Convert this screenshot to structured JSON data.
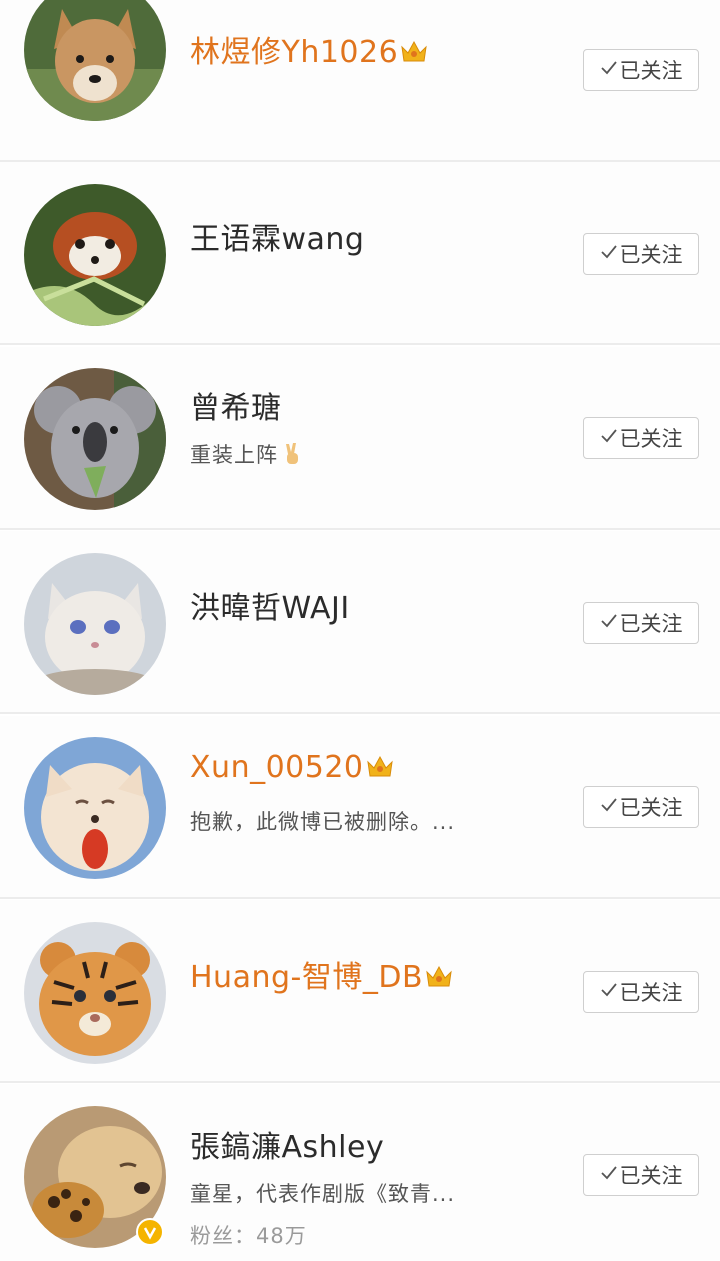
{
  "accent": {
    "vip_name_color": "#e0741d",
    "verified_badge_color": "#f5b400"
  },
  "users": [
    {
      "name": "林煜修Yh1026",
      "vip": true,
      "description": "",
      "follow_label": "已关注",
      "avatar_icon": "fox-cub-avatar"
    },
    {
      "name": "王语霖wang",
      "vip": false,
      "description": "",
      "follow_label": "已关注",
      "avatar_icon": "red-panda-avatar"
    },
    {
      "name": "曾希瑭",
      "vip": false,
      "description": "重装上阵",
      "description_emoji": "victory-hand-icon",
      "follow_label": "已关注",
      "avatar_icon": "koala-avatar"
    },
    {
      "name": "洪暐哲WAJI",
      "vip": false,
      "description": "",
      "follow_label": "已关注",
      "avatar_icon": "white-cat-avatar"
    },
    {
      "name": "Xun_00520",
      "vip": true,
      "description": "抱歉，此微博已被删除。...",
      "follow_label": "已关注",
      "avatar_icon": "arctic-fox-avatar"
    },
    {
      "name": "Huang-智博_DB",
      "vip": true,
      "description": "",
      "follow_label": "已关注",
      "avatar_icon": "tiger-cub-avatar"
    },
    {
      "name": "張鎬濂Ashley",
      "vip": false,
      "description": "童星，代表作剧版《致青...",
      "fans": "粉丝：48万",
      "verified": true,
      "follow_label": "已关注",
      "avatar_icon": "puppy-avatar"
    }
  ]
}
